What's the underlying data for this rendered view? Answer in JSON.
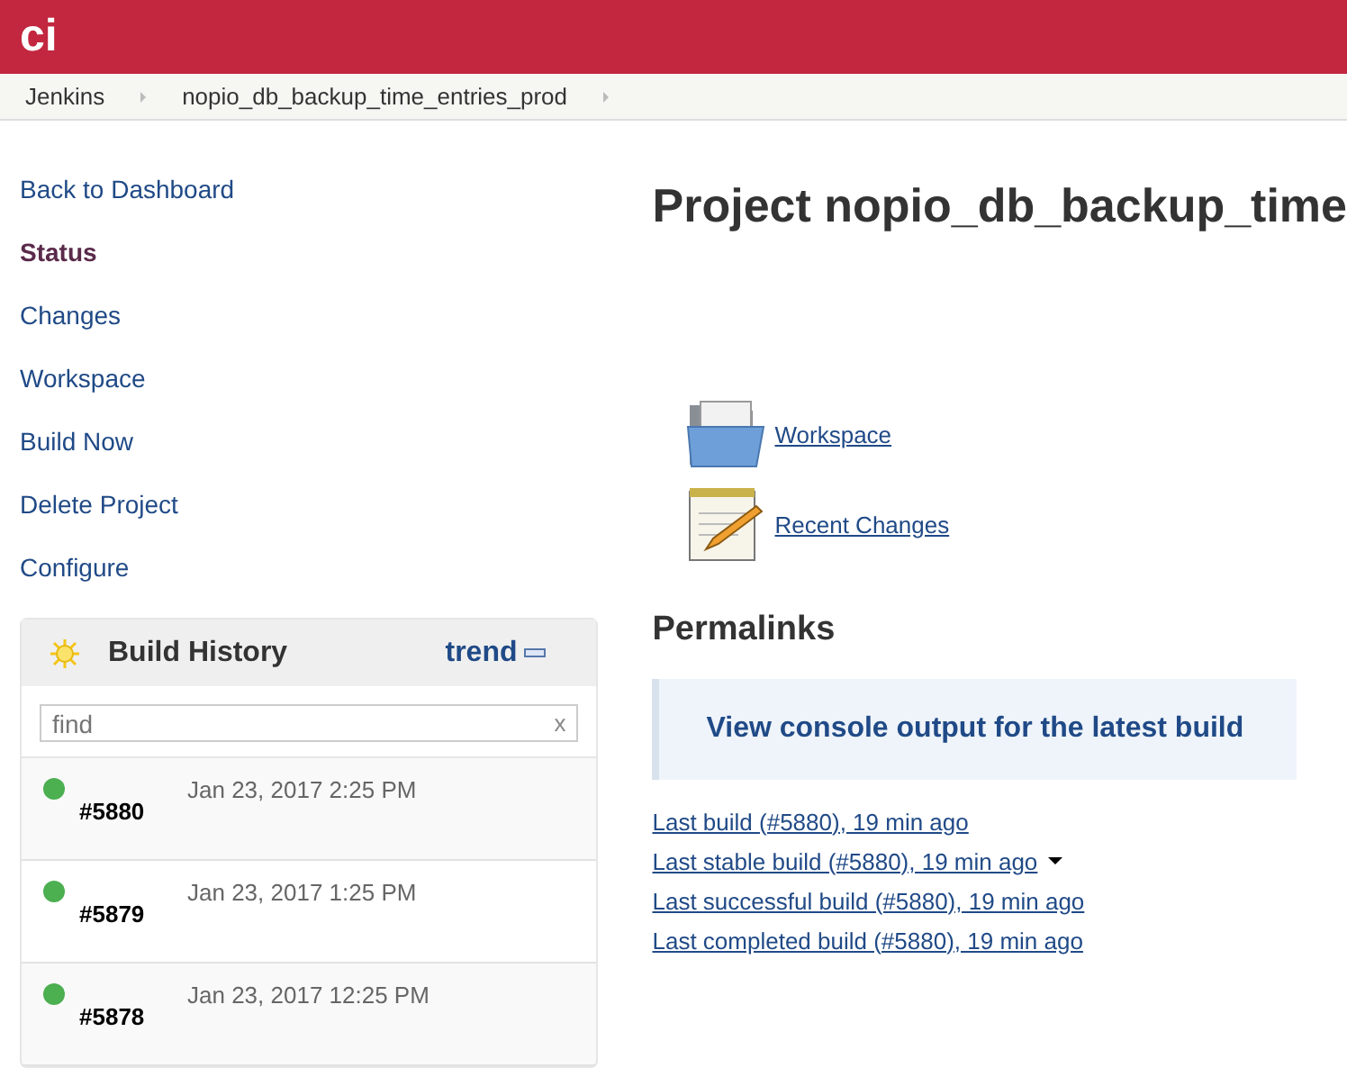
{
  "header": {
    "logo": "ci"
  },
  "breadcrumbs": [
    {
      "label": "Jenkins"
    },
    {
      "label": "nopio_db_backup_time_entries_prod"
    }
  ],
  "sidebar": {
    "items": [
      {
        "label": "Back to Dashboard",
        "selected": false
      },
      {
        "label": "Status",
        "selected": true
      },
      {
        "label": "Changes",
        "selected": false
      },
      {
        "label": "Workspace",
        "selected": false
      },
      {
        "label": "Build Now",
        "selected": false
      },
      {
        "label": "Delete Project",
        "selected": false
      },
      {
        "label": "Configure",
        "selected": false
      }
    ]
  },
  "build_history": {
    "title": "Build History",
    "trend": "trend",
    "search": {
      "placeholder": "find",
      "clear": "x"
    },
    "builds": [
      {
        "number": "#5880",
        "time": "Jan 23, 2017 2:25 PM",
        "color": "#4caf50"
      },
      {
        "number": "#5879",
        "time": "Jan 23, 2017 1:25 PM",
        "color": "#4caf50"
      },
      {
        "number": "#5878",
        "time": "Jan 23, 2017 12:25 PM",
        "color": "#4caf50"
      }
    ]
  },
  "main": {
    "title": "Project nopio_db_backup_time",
    "links": [
      {
        "kind": "folder",
        "label": "Workspace"
      },
      {
        "kind": "notepad",
        "label": "Recent Changes"
      }
    ],
    "permalinks_title": "Permalinks",
    "console_link": "View console output for the latest build",
    "permalinks": [
      {
        "label": "Last build (#5880), 19 min ago",
        "menu": false
      },
      {
        "label": "Last stable build (#5880), 19 min ago",
        "menu": true
      },
      {
        "label": "Last successful build (#5880), 19 min ago",
        "menu": false
      },
      {
        "label": "Last completed build (#5880), 19 min ago",
        "menu": false
      }
    ]
  }
}
